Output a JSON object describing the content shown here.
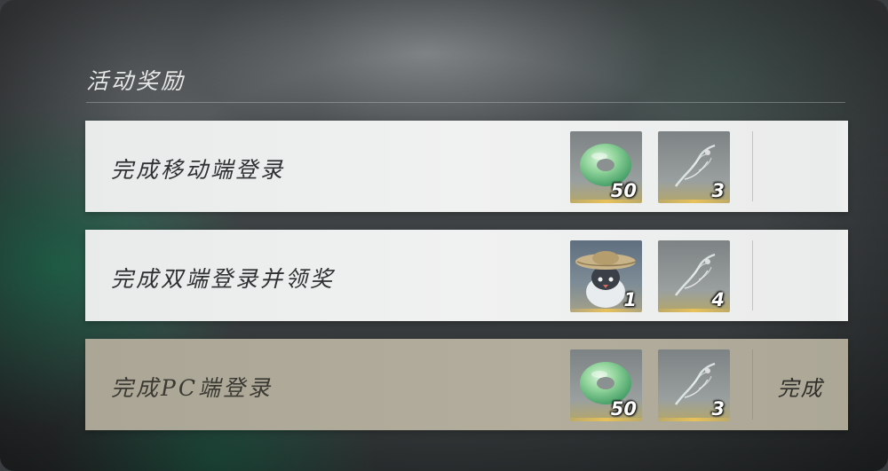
{
  "panel": {
    "title": "活动奖励"
  },
  "rows": [
    {
      "label": "完成移动端登录",
      "state": "incomplete",
      "status": "",
      "rewards": [
        {
          "icon": "jade-ring-icon",
          "count": "50"
        },
        {
          "icon": "spirit-feather-icon",
          "count": "3"
        }
      ]
    },
    {
      "label": "完成双端登录并领奖",
      "state": "incomplete",
      "status": "",
      "rewards": [
        {
          "icon": "straw-hat-pet-icon",
          "count": "1"
        },
        {
          "icon": "spirit-feather-icon",
          "count": "4"
        }
      ]
    },
    {
      "label": "完成PC端登录",
      "state": "completed",
      "status": "完成",
      "rewards": [
        {
          "icon": "jade-ring-icon",
          "count": "50"
        },
        {
          "icon": "spirit-feather-icon",
          "count": "3"
        }
      ]
    }
  ],
  "colors": {
    "row_background": "#eeefef",
    "completed_row_background": "#aea998",
    "reward_glow": "#e7c15a"
  }
}
